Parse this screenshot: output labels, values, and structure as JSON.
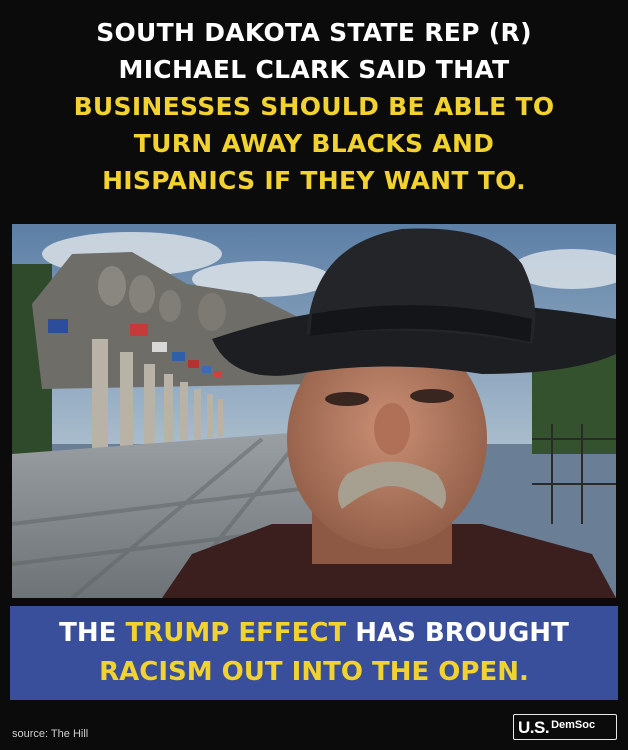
{
  "headline": {
    "line1": "SOUTH DAKOTA STATE REP (R)",
    "line2": "MICHAEL CLARK SAID THAT",
    "line3": "BUSINESSES SHOULD BE ABLE TO",
    "line4": "TURN AWAY BLACKS AND",
    "line5": "HISPANICS IF THEY WANT TO."
  },
  "bottom": {
    "line1_pre": "THE ",
    "line1_highlight": "TRUMP EFFECT",
    "line1_post": " HAS BROUGHT",
    "line2": "RACISM OUT INTO THE OPEN."
  },
  "footer": {
    "source": "source: The Hill",
    "logo_main": "U.S.",
    "logo_sub": "DemSoc"
  },
  "colors": {
    "background": "#0b0b0b",
    "highlight_yellow": "#f2d22e",
    "band_blue": "#3a4f9b"
  }
}
